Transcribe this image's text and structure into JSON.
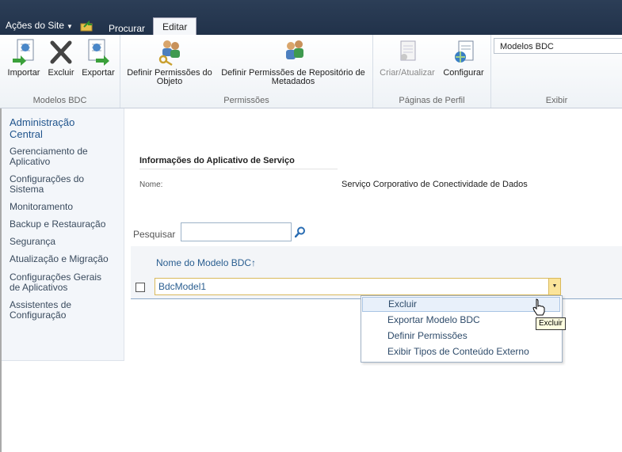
{
  "topbar": {
    "site_actions": "Ações do Site",
    "tabs": [
      {
        "label": "Procurar"
      },
      {
        "label": "Editar"
      }
    ]
  },
  "ribbon": {
    "groups": [
      {
        "label": "Modelos BDC",
        "buttons": [
          "Importar",
          "Excluir",
          "Exportar"
        ]
      },
      {
        "label": "Permissões",
        "buttons": [
          "Definir Permissões do Objeto",
          "Definir Permissões de Repositório de Metadados"
        ]
      },
      {
        "label": "Páginas de Perfil",
        "buttons": [
          "Criar/Atualizar",
          "Configurar"
        ]
      },
      {
        "label": "Exibir"
      }
    ],
    "view_select": "Modelos BDC"
  },
  "leftnav": {
    "title": "Administração Central",
    "items": [
      "Gerenciamento de Aplicativo",
      "Configurações do Sistema",
      "Monitoramento",
      "Backup e Restauração",
      "Segurança",
      "Atualização e Migração",
      "Configurações Gerais de Aplicativos",
      "Assistentes de Configuração"
    ]
  },
  "main": {
    "info_heading": "Informações do Aplicativo de Serviço",
    "name_label": "Nome:",
    "name_value": "Serviço Corporativo de Conectividade de Dados",
    "search_label": "Pesquisar",
    "search_value": "",
    "column_header": "Nome do Modelo BDC↑",
    "rows": [
      {
        "name": "BdcModel1"
      }
    ]
  },
  "context_menu": {
    "items": [
      "Excluir",
      "Exportar Modelo BDC",
      "Definir Permissões",
      "Exibir Tipos de Conteúdo Externo"
    ],
    "hovered": "Excluir"
  },
  "tooltip": "Excluir",
  "colors": {
    "topbar": "#2c3e57",
    "link": "#2a5e90",
    "hover": "#e8f0fa",
    "row_border": "#d9b95c"
  }
}
